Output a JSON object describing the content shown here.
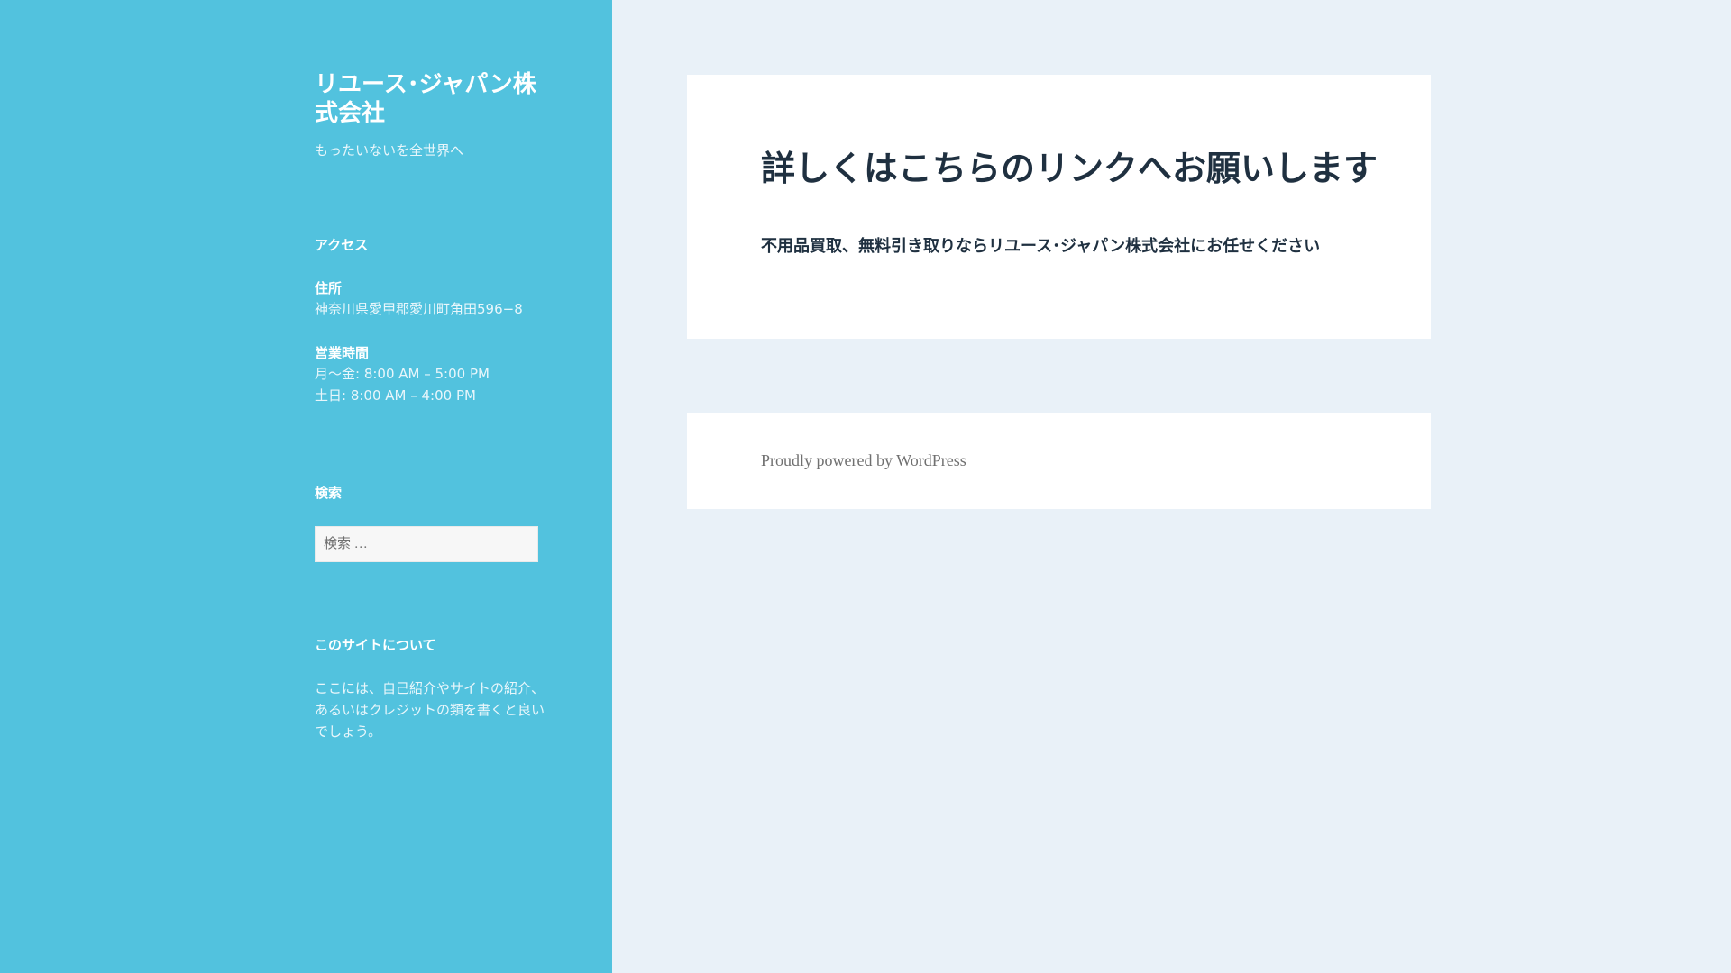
{
  "site": {
    "title": "リユース･ジャパン株式会社",
    "description": "もったいないを全世界へ"
  },
  "sidebar": {
    "access": {
      "title": "アクセス",
      "address_label": "住所",
      "address": "神奈川県愛甲郡愛川町角田596−8",
      "hours_label": "営業時間",
      "hours_weekday": "月〜金: 8:00 AM – 5:00 PM",
      "hours_weekend": "土日: 8:00 AM – 4:00 PM"
    },
    "search": {
      "title": "検索",
      "placeholder": "検索 …"
    },
    "about": {
      "title": "このサイトについて",
      "lines": [
        "ここには、自己紹介やサイトの紹介、",
        "あるいはクレジットの類を書くと良い",
        "でしょう。"
      ]
    }
  },
  "post": {
    "title": "詳しくはこちらのリンクへお願いします",
    "link_text": "不用品買取、無料引き取りならリユース･ジャパン株式会社にお任せください"
  },
  "footer": {
    "credit": "Proudly powered by WordPress"
  }
}
